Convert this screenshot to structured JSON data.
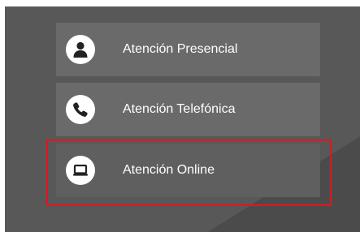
{
  "options": [
    {
      "label": "Atención Presencial",
      "icon": "person-icon"
    },
    {
      "label": "Atención Telefónica",
      "icon": "phone-icon"
    },
    {
      "label": "Atención Online",
      "icon": "laptop-icon"
    }
  ],
  "highlight": {
    "color": "#e3141e",
    "target": "Atención Online"
  },
  "colors": {
    "panel_background": "#585858",
    "button_background": "#6a6a6a",
    "text": "#ffffff"
  }
}
